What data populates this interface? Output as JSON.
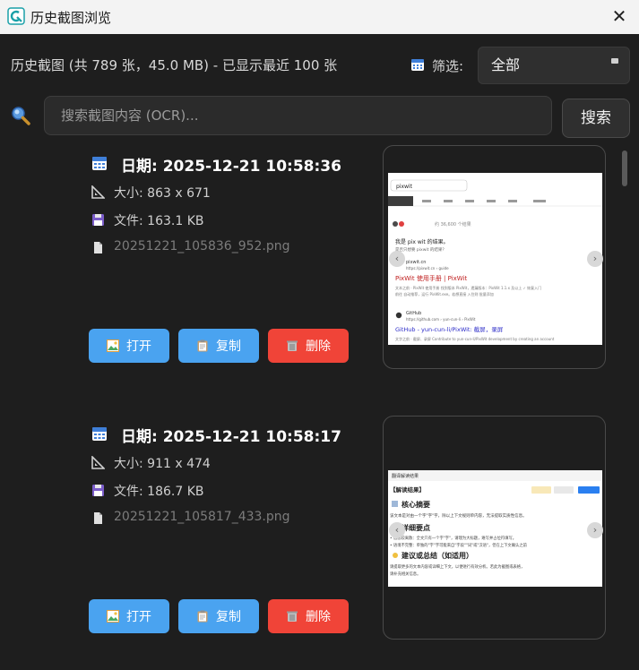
{
  "window": {
    "title": "历史截图浏览",
    "close_glyph": "✕"
  },
  "header": {
    "summary": "历史截图 (共 789 张，45.0 MB) - 已显示最近 100 张",
    "filter_label": "筛选:",
    "filter_value": "全部"
  },
  "search": {
    "placeholder": "搜索截图内容 (OCR)...",
    "button_label": "搜索"
  },
  "cards": [
    {
      "date": "日期: 2025-12-21 10:58:36",
      "size": "大小: 863 x 671",
      "file_size": "文件: 163.1 KB",
      "file_name": "20251221_105836_952.png",
      "open_label": "打开",
      "copy_label": "复制",
      "delete_label": "删除"
    },
    {
      "date": "日期: 2025-12-21 10:58:17",
      "size": "大小: 911 x 474",
      "file_size": "文件: 186.7 KB",
      "file_name": "20251221_105817_433.png",
      "open_label": "打开",
      "copy_label": "复制",
      "delete_label": "删除"
    }
  ],
  "thumb1": {
    "query": "pixwit",
    "result_count": "约 36,600 个结果",
    "ai_text": "我是 pix wit 的结果。",
    "ai_sub": "是否只想要 pixwit 的结果？",
    "site1": "pixwit.cn",
    "url1": "https://pixwit.cn › guide",
    "link1": "PixWit 使用手册 | PixWit",
    "desc1": "文本之前 · PixWit 使用手册 找到版本 PixWit，遗漏版本：PixWit 1.1.x 及以上 ✓ 恢复入门",
    "desc1b": "前往 自动推荐，运行 PixWit.exe。若想直接 入住则 批量添加",
    "site2": "GitHub",
    "url2": "https://github.com › yun-cun-li › PixWit",
    "link2": "GitHub - yun-cun-li/PixWit: 截屏，录屏",
    "desc2": "文字之前 · 截屏、录屏 Contribute to yun-cun-li/PixWit development by creating an account"
  },
  "thumb2": {
    "header": "翻译解读结果",
    "section_title": "【解读结果】",
    "h1": "核心摘要",
    "p1": "该文本是对由一个字\"字\"字，除以上下文规则单内容，无法提取实质性信息。",
    "h2": "详细要点",
    "p2a": "• 信息较离散：全文只有一个字\"字\"，请理为大标题，难写并占位符填写。",
    "p2b": "• 语境不完整：单独的\"字\"字可能来自\"字段\"\"词\"或\"汉语\"，但在上下文确认之前",
    "h3": "建议或总结（如适用）",
    "p3": "请提取更多的文本内容或详细上下文，以便进行有效分析。若此为截图或表格，",
    "p3b": "请补充相关信息。"
  }
}
